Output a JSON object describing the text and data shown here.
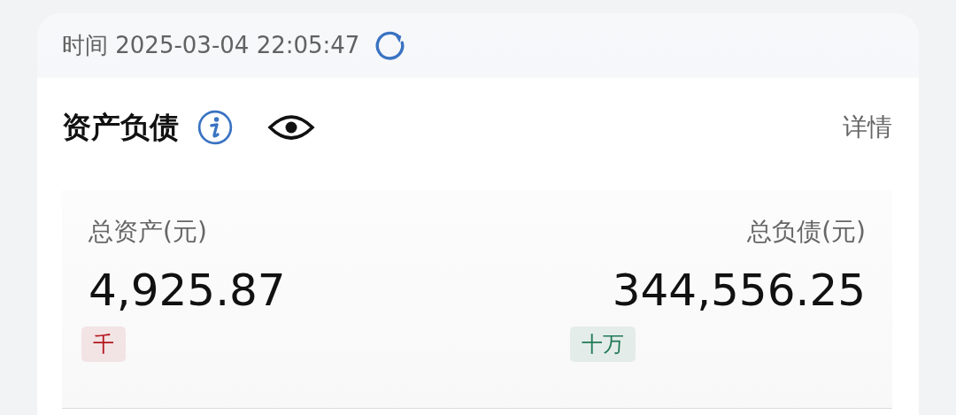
{
  "timestamp": {
    "label": "时间",
    "value": "2025-03-04 22:05:47"
  },
  "section": {
    "title": "资产负债",
    "detail_link": "详情"
  },
  "totals": [
    {
      "label": "总资产(元)",
      "value": "4,925.87",
      "unit": "千",
      "color": "#b3161d"
    },
    {
      "label": "总负债(元)",
      "value": "344,556.25",
      "unit": "十万",
      "color": "#1f7a55"
    }
  ]
}
